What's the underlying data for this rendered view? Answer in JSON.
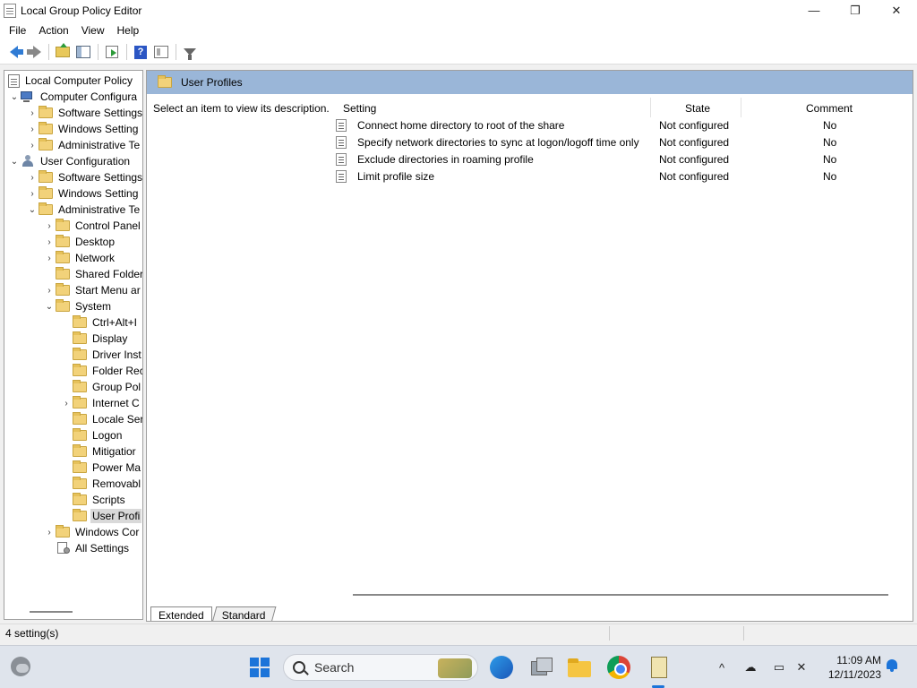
{
  "window": {
    "title": "Local Group Policy Editor",
    "controls": {
      "minimize": "—",
      "restore": "❐",
      "close": "✕"
    }
  },
  "menu": [
    "File",
    "Action",
    "View",
    "Help"
  ],
  "toolbar": {
    "buttons": [
      "back-icon",
      "forward-icon",
      "up-one-level-icon",
      "show-hide-tree-icon",
      "export-list-icon",
      "help-icon",
      "show-hide-action-pane-icon",
      "filter-icon"
    ]
  },
  "tree": {
    "root": "Local Computer Policy",
    "computer_configuration": "Computer Configura",
    "cc_software_settings": "Software Settings",
    "cc_windows_settings": "Windows Setting",
    "cc_administrative_templates": "Administrative Te",
    "user_configuration": "User Configuration",
    "uc_software_settings": "Software Settings",
    "uc_windows_settings": "Windows Setting",
    "uc_administrative_templates": "Administrative Te",
    "control_panel": "Control Panel",
    "desktop": "Desktop",
    "network": "Network",
    "shared_folders": "Shared Folder",
    "start_menu": "Start Menu ar",
    "system": "System",
    "ctrl_alt_del": "Ctrl+Alt+I",
    "display": "Display",
    "driver_installation": "Driver Inst",
    "folder_redirection": "Folder Rec",
    "group_policy": "Group Pol",
    "internet_communication": "Internet C",
    "locale_services": "Locale Ser",
    "logon": "Logon",
    "mitigation": "Mitigatior",
    "power_management": "Power Ma",
    "removable_storage": "Removabl",
    "scripts": "Scripts",
    "user_profiles": "User Profi",
    "windows_components": "Windows Cor",
    "all_settings": "All Settings"
  },
  "right_pane": {
    "header_title": "User Profiles",
    "description": "Select an item to view its description.",
    "columns": {
      "setting": "Setting",
      "state": "State",
      "comment": "Comment"
    },
    "rows": [
      {
        "setting": "Connect home directory to root of the share",
        "state": "Not configured",
        "comment": "No"
      },
      {
        "setting": "Specify network directories to sync at logon/logoff time only",
        "state": "Not configured",
        "comment": "No"
      },
      {
        "setting": "Exclude directories in roaming profile",
        "state": "Not configured",
        "comment": "No"
      },
      {
        "setting": "Limit profile size",
        "state": "Not configured",
        "comment": "No"
      }
    ],
    "tabs": {
      "extended": "Extended",
      "standard": "Standard"
    }
  },
  "status": {
    "text": "4 setting(s)"
  },
  "taskbar": {
    "search_label": "Search",
    "time": "11:09 AM",
    "date": "12/11/2023",
    "tray_icons": [
      "chevron-up-icon",
      "onedrive-icon",
      "network-icon",
      "volume-mute-icon"
    ],
    "tray_glyphs": {
      "chevron": "^",
      "cloud": "☁",
      "network": "▭",
      "volume": "✕"
    }
  },
  "colors": {
    "header_band": "#9ab6d8",
    "taskbar": "#dfe4ec",
    "accent": "#1c74d9"
  }
}
